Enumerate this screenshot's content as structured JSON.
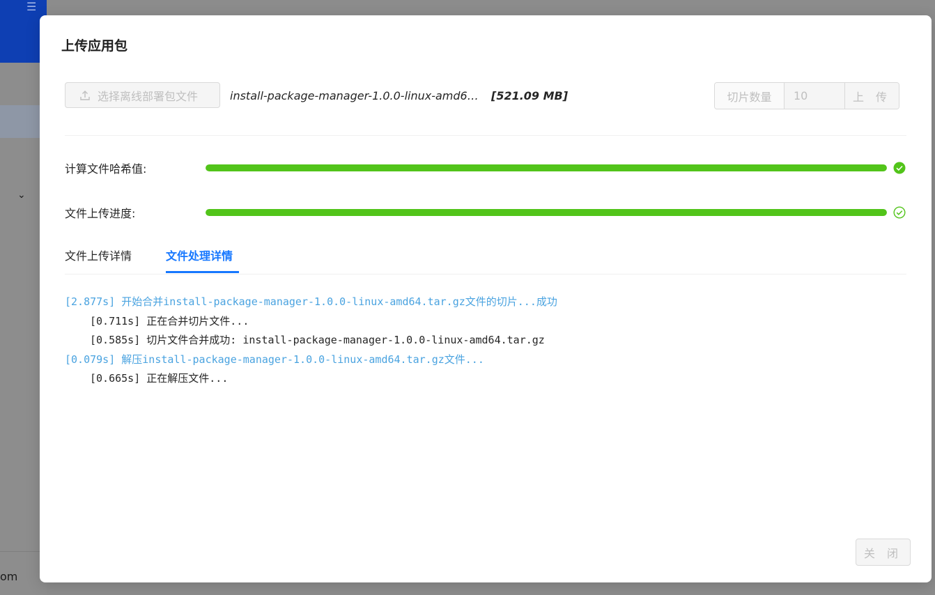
{
  "background": {
    "footer_text": "om",
    "menu_icon": "menu-collapse-icon",
    "chevron_icon": "chevron-down-icon"
  },
  "modal": {
    "title": "上传应用包",
    "select_button_label": "选择离线部署包文件",
    "file_name": "install-package-manager-1.0.0-linux-amd64.t...",
    "file_size": "[521.09 MB]",
    "slice_label": "切片数量",
    "slice_value": "10",
    "upload_button_label": "上 传",
    "close_button_label": "关 闭"
  },
  "progress": [
    {
      "label": "计算文件哈希值:",
      "percent": 100,
      "status": "success-filled",
      "color": "#52c41a"
    },
    {
      "label": "文件上传进度:",
      "percent": 100,
      "status": "success-outline",
      "color": "#52c41a"
    }
  ],
  "tabs": [
    {
      "label": "文件上传详情",
      "active": false
    },
    {
      "label": "文件处理详情",
      "active": true
    }
  ],
  "log": [
    {
      "level": "parent",
      "text": "[2.877s] 开始合并install-package-manager-1.0.0-linux-amd64.tar.gz文件的切片...成功"
    },
    {
      "level": "child",
      "text": "[0.711s] 正在合并切片文件..."
    },
    {
      "level": "child",
      "text": "[0.585s] 切片文件合并成功: install-package-manager-1.0.0-linux-amd64.tar.gz"
    },
    {
      "level": "parent",
      "text": "[0.079s] 解压install-package-manager-1.0.0-linux-amd64.tar.gz文件..."
    },
    {
      "level": "child",
      "text": "[0.665s] 正在解压文件..."
    }
  ],
  "colors": {
    "accent": "#1677ff",
    "success": "#52c41a",
    "log_parent": "#4aa3e0",
    "brand_sidebar": "#0e3fb3"
  }
}
